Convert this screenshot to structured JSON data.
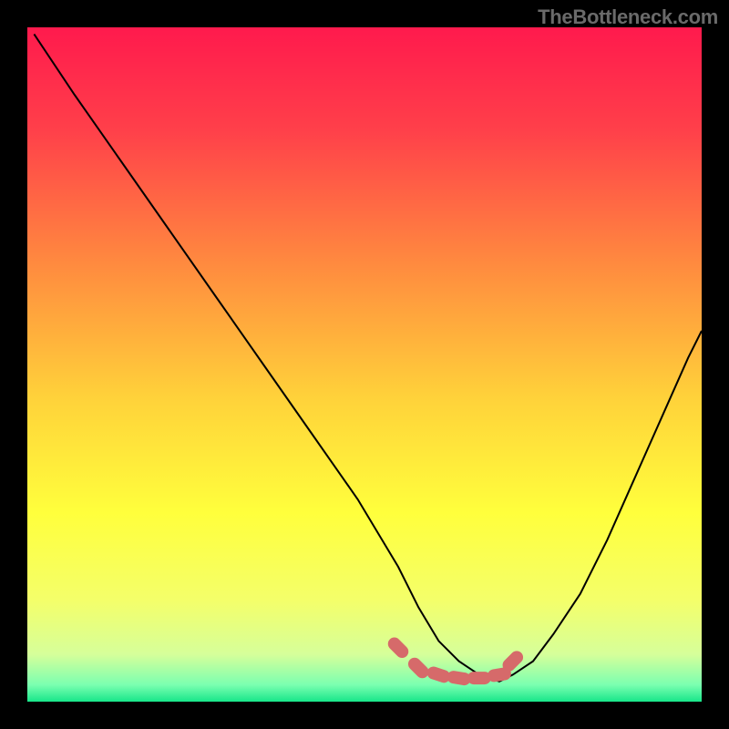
{
  "watermark": "TheBottleneck.com",
  "chart_data": {
    "type": "line",
    "title": "",
    "xlabel": "",
    "ylabel": "",
    "xlim": [
      0,
      100
    ],
    "ylim": [
      0,
      100
    ],
    "grid": false,
    "legend": false,
    "gradient_stops": [
      {
        "pos": 0.0,
        "color": "#ff1a4d"
      },
      {
        "pos": 0.15,
        "color": "#ff3f4a"
      },
      {
        "pos": 0.35,
        "color": "#ff8a3f"
      },
      {
        "pos": 0.55,
        "color": "#ffd23a"
      },
      {
        "pos": 0.72,
        "color": "#ffff3c"
      },
      {
        "pos": 0.85,
        "color": "#f4ff6a"
      },
      {
        "pos": 0.93,
        "color": "#d6ff9a"
      },
      {
        "pos": 0.975,
        "color": "#7bffb0"
      },
      {
        "pos": 1.0,
        "color": "#18e68a"
      }
    ],
    "series": [
      {
        "name": "bottleneck-curve",
        "color": "#000000",
        "width": 2,
        "x": [
          1,
          7,
          14,
          21,
          28,
          35,
          42,
          49,
          55,
          58,
          61,
          64,
          67,
          70,
          72,
          75,
          78,
          82,
          86,
          90,
          94,
          98,
          100
        ],
        "y": [
          99,
          90,
          80,
          70,
          60,
          50,
          40,
          30,
          20,
          14,
          9,
          6,
          4,
          3,
          4,
          6,
          10,
          16,
          24,
          33,
          42,
          51,
          55
        ]
      },
      {
        "name": "optimal-band",
        "color": "#d66a6a",
        "type": "scatter",
        "marker": "capsule",
        "x": [
          55,
          58,
          61,
          64,
          67,
          70,
          72
        ],
        "y": [
          8,
          5,
          4,
          3.5,
          3.5,
          4,
          6
        ]
      }
    ],
    "annotations": []
  }
}
